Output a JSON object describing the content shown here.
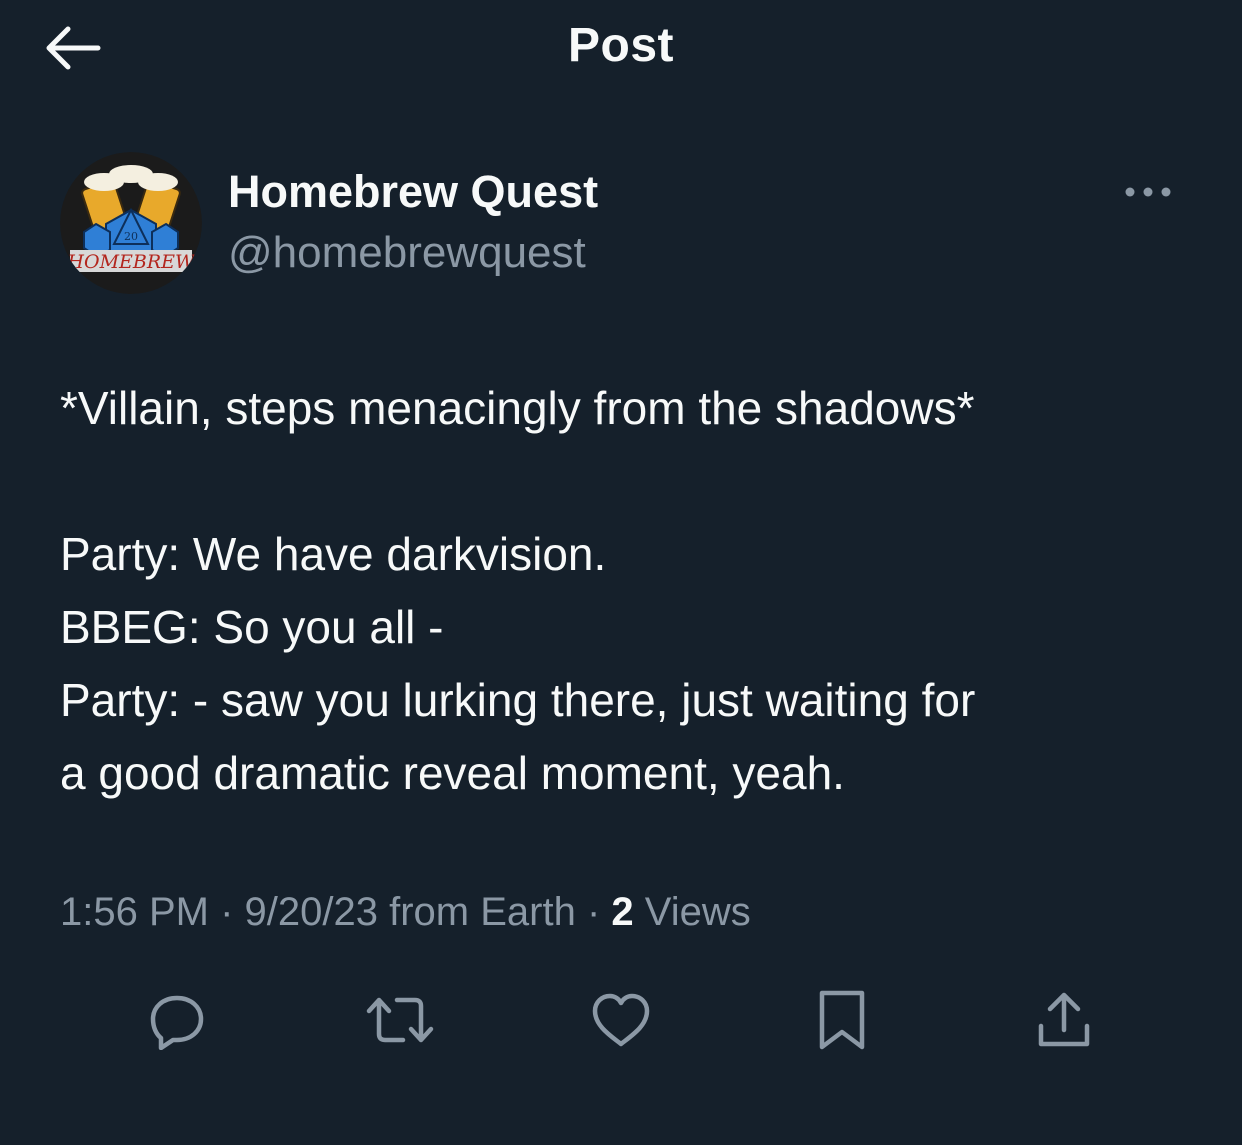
{
  "header": {
    "title": "Post",
    "back_icon": "arrow-left-icon"
  },
  "author": {
    "display_name": "Homebrew Quest",
    "handle": "@homebrewquest",
    "avatar_text": "HOMEBREW",
    "avatar_die_text": "20",
    "more_icon": "more-dots-icon"
  },
  "tweet": {
    "lines": [
      "*Villain, steps menacingly from the shadows*",
      "",
      "Party: We have darkvision.",
      "BBEG: So you all -",
      "Party: - saw you lurking there, just waiting for",
      "a good dramatic reveal moment, yeah."
    ]
  },
  "meta": {
    "time": "1:56 PM",
    "separator": " · ",
    "date": "9/20/23",
    "source": " from Earth",
    "views_count": "2",
    "views_label": " Views"
  },
  "actions": [
    {
      "name": "reply",
      "icon": "reply-icon"
    },
    {
      "name": "repost",
      "icon": "repost-icon"
    },
    {
      "name": "like",
      "icon": "heart-icon"
    },
    {
      "name": "bookmark",
      "icon": "bookmark-icon"
    },
    {
      "name": "share",
      "icon": "share-icon"
    }
  ],
  "colors": {
    "background": "#15202b",
    "text_primary": "#f7f9f9",
    "text_secondary": "#8b98a5"
  }
}
